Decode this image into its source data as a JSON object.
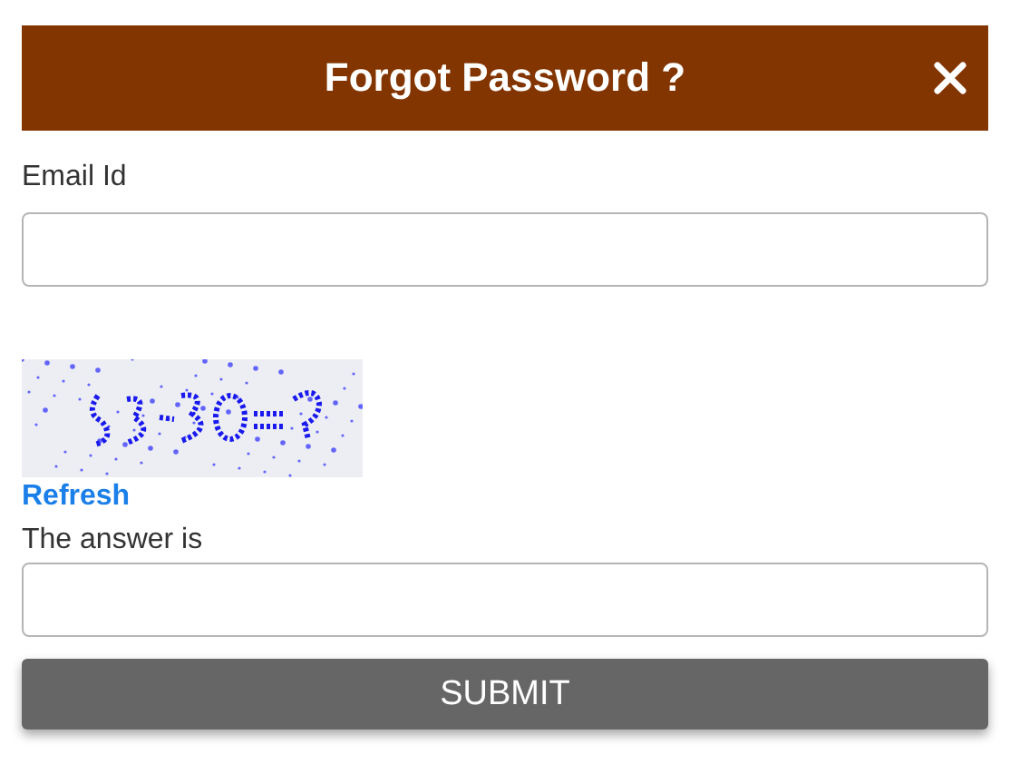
{
  "dialog": {
    "title": "Forgot Password ?"
  },
  "email": {
    "label": "Email Id"
  },
  "captcha": {
    "kind": "picture",
    "refresh": "Refresh"
  },
  "answer": {
    "label": "The answer is"
  },
  "submit": {
    "label": "SUBMIT"
  }
}
